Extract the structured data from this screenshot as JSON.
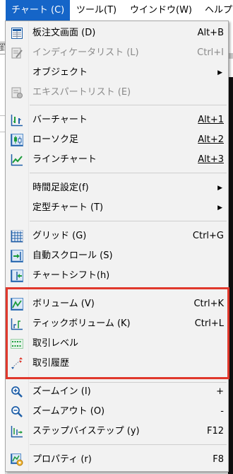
{
  "menubar": {
    "items": [
      {
        "label": "チャート (C)",
        "active": true
      },
      {
        "label": "ツール(T)"
      },
      {
        "label": "ウインドウ(W)"
      },
      {
        "label": "ヘルプ"
      }
    ]
  },
  "background": {
    "left_fragment_text": "罫"
  },
  "menu": {
    "items": [
      {
        "label": "板注文画面 (D)",
        "shortcut": "Alt+B",
        "icon": "order-board-icon"
      },
      {
        "label": "インディケータリスト (L)",
        "shortcut": "Ctrl+I",
        "icon": "indicator-list-icon",
        "disabled": true
      },
      {
        "label": "オブジェクト",
        "submenu": true
      },
      {
        "label": "エキスパートリスト (E)",
        "icon": "expert-list-icon",
        "disabled": true
      },
      {
        "label": "バーチャート",
        "shortcut": "Alt+1",
        "icon": "bar-chart-icon"
      },
      {
        "label": "ローソク足",
        "shortcut": "Alt+2",
        "icon": "candlestick-icon"
      },
      {
        "label": "ラインチャート",
        "shortcut": "Alt+3",
        "icon": "line-chart-icon"
      },
      {
        "label": "時間足設定(f)",
        "submenu": true
      },
      {
        "label": "定型チャート (T)",
        "submenu": true
      },
      {
        "label": "グリッド (G)",
        "shortcut": "Ctrl+G",
        "icon": "grid-icon"
      },
      {
        "label": "自動スクロール (S)",
        "icon": "auto-scroll-icon"
      },
      {
        "label": "チャートシフト(h)",
        "icon": "chart-shift-icon"
      },
      {
        "label": "ボリューム (V)",
        "shortcut": "Ctrl+K",
        "icon": "volume-icon"
      },
      {
        "label": "ティックボリューム (K)",
        "shortcut": "Ctrl+L",
        "icon": "tick-volume-icon"
      },
      {
        "label": "取引レベル",
        "icon": "trade-levels-icon"
      },
      {
        "label": "取引履歴",
        "icon": "trade-history-icon"
      },
      {
        "label": "ズームイン (I)",
        "shortcut": "+",
        "icon": "zoom-in-icon"
      },
      {
        "label": "ズームアウト (O)",
        "shortcut": "-",
        "icon": "zoom-out-icon"
      },
      {
        "label": "ステップバイステップ (y)",
        "shortcut": "F12",
        "icon": "step-by-step-icon"
      },
      {
        "label": "プロパティ (r)",
        "shortcut": "F8",
        "icon": "properties-icon"
      }
    ]
  },
  "colors": {
    "menubar_active": "#1565c8",
    "highlight_border": "#e0382c",
    "icon_blue": "#1f5fa8",
    "icon_green": "#1a9b3a"
  }
}
